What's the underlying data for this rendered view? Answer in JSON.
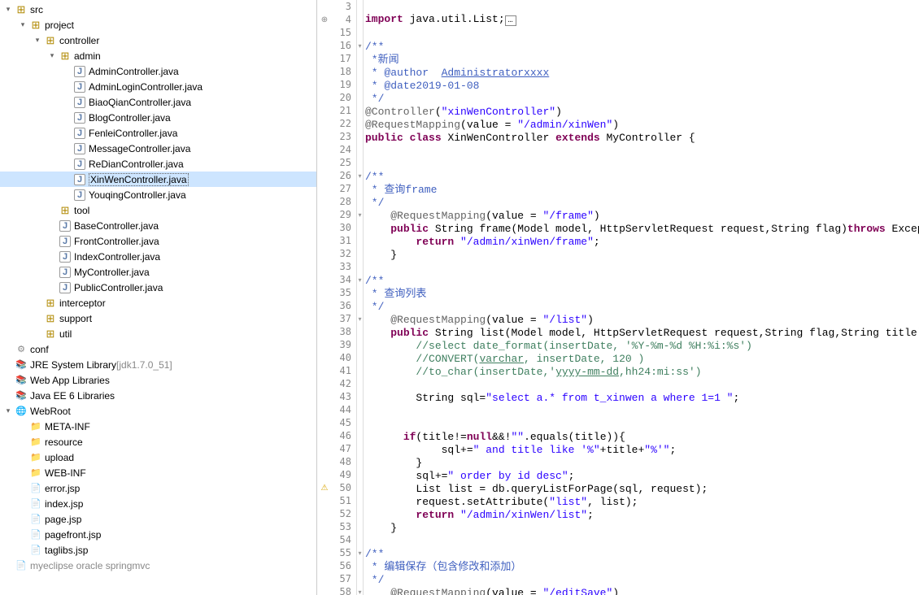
{
  "tree": [
    {
      "level": 0,
      "exp": "▾",
      "icon": "pkg",
      "text": "src"
    },
    {
      "level": 1,
      "exp": "▾",
      "icon": "pkg",
      "text": "project"
    },
    {
      "level": 2,
      "exp": "▾",
      "icon": "pkg",
      "text": "controller"
    },
    {
      "level": 3,
      "exp": "▾",
      "icon": "pkg",
      "text": "admin"
    },
    {
      "level": 4,
      "exp": "",
      "icon": "java",
      "text": "AdminController.java"
    },
    {
      "level": 4,
      "exp": "",
      "icon": "java",
      "text": "AdminLoginController.java"
    },
    {
      "level": 4,
      "exp": "",
      "icon": "java",
      "text": "BiaoQianController.java"
    },
    {
      "level": 4,
      "exp": "",
      "icon": "java",
      "text": "BlogController.java"
    },
    {
      "level": 4,
      "exp": "",
      "icon": "java",
      "text": "FenleiController.java"
    },
    {
      "level": 4,
      "exp": "",
      "icon": "java",
      "text": "MessageController.java"
    },
    {
      "level": 4,
      "exp": "",
      "icon": "java",
      "text": "ReDianController.java"
    },
    {
      "level": 4,
      "exp": "",
      "icon": "java",
      "text": "XinWenController.java",
      "selected": true
    },
    {
      "level": 4,
      "exp": "",
      "icon": "java",
      "text": "YouqingController.java"
    },
    {
      "level": 3,
      "exp": "",
      "icon": "pkg",
      "text": "tool"
    },
    {
      "level": 3,
      "exp": "",
      "icon": "java",
      "text": "BaseController.java"
    },
    {
      "level": 3,
      "exp": "",
      "icon": "java",
      "text": "FrontController.java"
    },
    {
      "level": 3,
      "exp": "",
      "icon": "java",
      "text": "IndexController.java"
    },
    {
      "level": 3,
      "exp": "",
      "icon": "java",
      "text": "MyController.java"
    },
    {
      "level": 3,
      "exp": "",
      "icon": "java",
      "text": "PublicController.java"
    },
    {
      "level": 2,
      "exp": "",
      "icon": "pkg",
      "text": "interceptor"
    },
    {
      "level": 2,
      "exp": "",
      "icon": "pkg",
      "text": "support"
    },
    {
      "level": 2,
      "exp": "",
      "icon": "pkg",
      "text": "util"
    },
    {
      "level": 0,
      "exp": "",
      "icon": "conf",
      "text": "conf"
    },
    {
      "level": 0,
      "exp": "",
      "icon": "lib",
      "text": "JRE System Library ",
      "extra": "[jdk1.7.0_51]"
    },
    {
      "level": 0,
      "exp": "",
      "icon": "lib",
      "text": "Web App Libraries"
    },
    {
      "level": 0,
      "exp": "",
      "icon": "lib",
      "text": "Java EE 6 Libraries"
    },
    {
      "level": 0,
      "exp": "▾",
      "icon": "web",
      "text": "WebRoot"
    },
    {
      "level": 1,
      "exp": "",
      "icon": "folder",
      "text": "META-INF"
    },
    {
      "level": 1,
      "exp": "",
      "icon": "folder",
      "text": "resource"
    },
    {
      "level": 1,
      "exp": "",
      "icon": "folder",
      "text": "upload"
    },
    {
      "level": 1,
      "exp": "",
      "icon": "folder",
      "text": "WEB-INF"
    },
    {
      "level": 1,
      "exp": "",
      "icon": "file",
      "text": "error.jsp"
    },
    {
      "level": 1,
      "exp": "",
      "icon": "file",
      "text": "index.jsp"
    },
    {
      "level": 1,
      "exp": "",
      "icon": "file",
      "text": "page.jsp"
    },
    {
      "level": 1,
      "exp": "",
      "icon": "file",
      "text": "pagefront.jsp"
    },
    {
      "level": 1,
      "exp": "",
      "icon": "file",
      "text": "taglibs.jsp"
    },
    {
      "level": 0,
      "exp": "",
      "icon": "file",
      "text": "myeclipse oracle springmvc",
      "gray": true
    }
  ],
  "lines": [
    {
      "num": 3,
      "html": ""
    },
    {
      "num": 4,
      "marker": "⊕",
      "html": "<span class='kw'>import</span> java.util.List;<span class='box'>…</span>"
    },
    {
      "num": 15,
      "html": ""
    },
    {
      "num": 16,
      "fold": "▾",
      "html": "<span class='cmt-blk'>/**</span>"
    },
    {
      "num": 17,
      "html": "<span class='cmt-blk'> *新闻</span>"
    },
    {
      "num": 18,
      "html": "<span class='cmt-blk'> * </span><span class='cmt-tag'>@author</span>  <span class='cmt-link'>Administratorxxxx</span>"
    },
    {
      "num": 19,
      "html": "<span class='cmt-blk'> * </span><span class='cmt-tag'>@date</span><span class='cmt-blk'>2019-01-08</span>"
    },
    {
      "num": 20,
      "html": "<span class='cmt-blk'> */</span>"
    },
    {
      "num": 21,
      "html": "<span class='ann'>@Controller</span>(<span class='str'>\"xinWenController\"</span>)"
    },
    {
      "num": 22,
      "html": "<span class='ann'>@RequestMapping</span>(value = <span class='str'>\"/admin/xinWen\"</span>)"
    },
    {
      "num": 23,
      "html": "<span class='kw'>public</span> <span class='kw'>class</span> XinWenController <span class='kw'>extends</span> MyController {"
    },
    {
      "num": 24,
      "html": ""
    },
    {
      "num": 25,
      "html": ""
    },
    {
      "num": 26,
      "fold": "▾",
      "html": "<span class='cmt-blk'>/**</span>"
    },
    {
      "num": 27,
      "html": "<span class='cmt-blk'> * 查询frame</span>"
    },
    {
      "num": 28,
      "html": "<span class='cmt-blk'> */</span>"
    },
    {
      "num": 29,
      "fold": "▾",
      "html": "    <span class='ann'>@RequestMapping</span>(value = <span class='str'>\"/frame\"</span>)"
    },
    {
      "num": 30,
      "html": "    <span class='kw'>public</span> String frame(Model model, HttpServletRequest request,String flag)<span class='kw'>throws</span> Exception {"
    },
    {
      "num": 31,
      "html": "        <span class='kw'>return</span> <span class='str'>\"/admin/xinWen/frame\"</span>;"
    },
    {
      "num": 32,
      "html": "    }"
    },
    {
      "num": 33,
      "html": ""
    },
    {
      "num": 34,
      "fold": "▾",
      "html": "<span class='cmt-blk'>/**</span>"
    },
    {
      "num": 35,
      "html": "<span class='cmt-blk'> * 查询列表</span>"
    },
    {
      "num": 36,
      "html": "<span class='cmt-blk'> */</span>"
    },
    {
      "num": 37,
      "fold": "▾",
      "html": "    <span class='ann'>@RequestMapping</span>(value = <span class='str'>\"/list\"</span>)"
    },
    {
      "num": 38,
      "html": "    <span class='kw'>public</span> String list(Model model, HttpServletRequest request,String flag,String title)<span class='kw'>throws</span> Exc"
    },
    {
      "num": 39,
      "html": "        <span class='cmt'>//select date_format(insertDate, '%Y-%m-%d %H:%i:%s')</span>"
    },
    {
      "num": 40,
      "html": "        <span class='cmt'>//CONVERT(</span><span class='cmt' style='text-decoration:underline'>varchar</span><span class='cmt'>, insertDate, 120 )</span>"
    },
    {
      "num": 41,
      "html": "        <span class='cmt'>//to_char(insertDate,'</span><span class='cmt' style='text-decoration:underline'>yyyy-mm-dd</span><span class='cmt'>,hh24:mi:ss')</span>"
    },
    {
      "num": 42,
      "html": ""
    },
    {
      "num": 43,
      "html": "        String sql=<span class='str'>\"select a.* from t_xinwen a where 1=1 \"</span>;"
    },
    {
      "num": 44,
      "html": ""
    },
    {
      "num": 45,
      "html": ""
    },
    {
      "num": 46,
      "html": "      <span class='kw'>if</span>(title!=<span class='kw'>null</span>&amp;&amp;!<span class='str'>\"\"</span>.equals(title)){"
    },
    {
      "num": 47,
      "html": "            sql+=<span class='str'>\" and title like '%\"</span>+title+<span class='str'>\"%'\"</span>;"
    },
    {
      "num": 48,
      "html": "        }"
    },
    {
      "num": 49,
      "html": "        sql+=<span class='str'>\" order by id desc\"</span>;"
    },
    {
      "num": 50,
      "marker": "⚠",
      "html": "        List list = db.queryListForPage(sql, request);"
    },
    {
      "num": 51,
      "html": "        request.setAttribute(<span class='str'>\"list\"</span>, list);"
    },
    {
      "num": 52,
      "html": "        <span class='kw'>return</span> <span class='str'>\"/admin/xinWen/list\"</span>;"
    },
    {
      "num": 53,
      "html": "    }"
    },
    {
      "num": 54,
      "html": ""
    },
    {
      "num": 55,
      "fold": "▾",
      "html": "<span class='cmt-blk'>/**</span>"
    },
    {
      "num": 56,
      "html": "<span class='cmt-blk'> * 编辑保存（包含修改和添加）</span>"
    },
    {
      "num": 57,
      "html": "<span class='cmt-blk'> */</span>"
    },
    {
      "num": 58,
      "fold": "▾",
      "html": "    <span class='ann'>@RequestMapping</span>(value = <span class='str'>\"/editSave\"</span>)"
    }
  ]
}
